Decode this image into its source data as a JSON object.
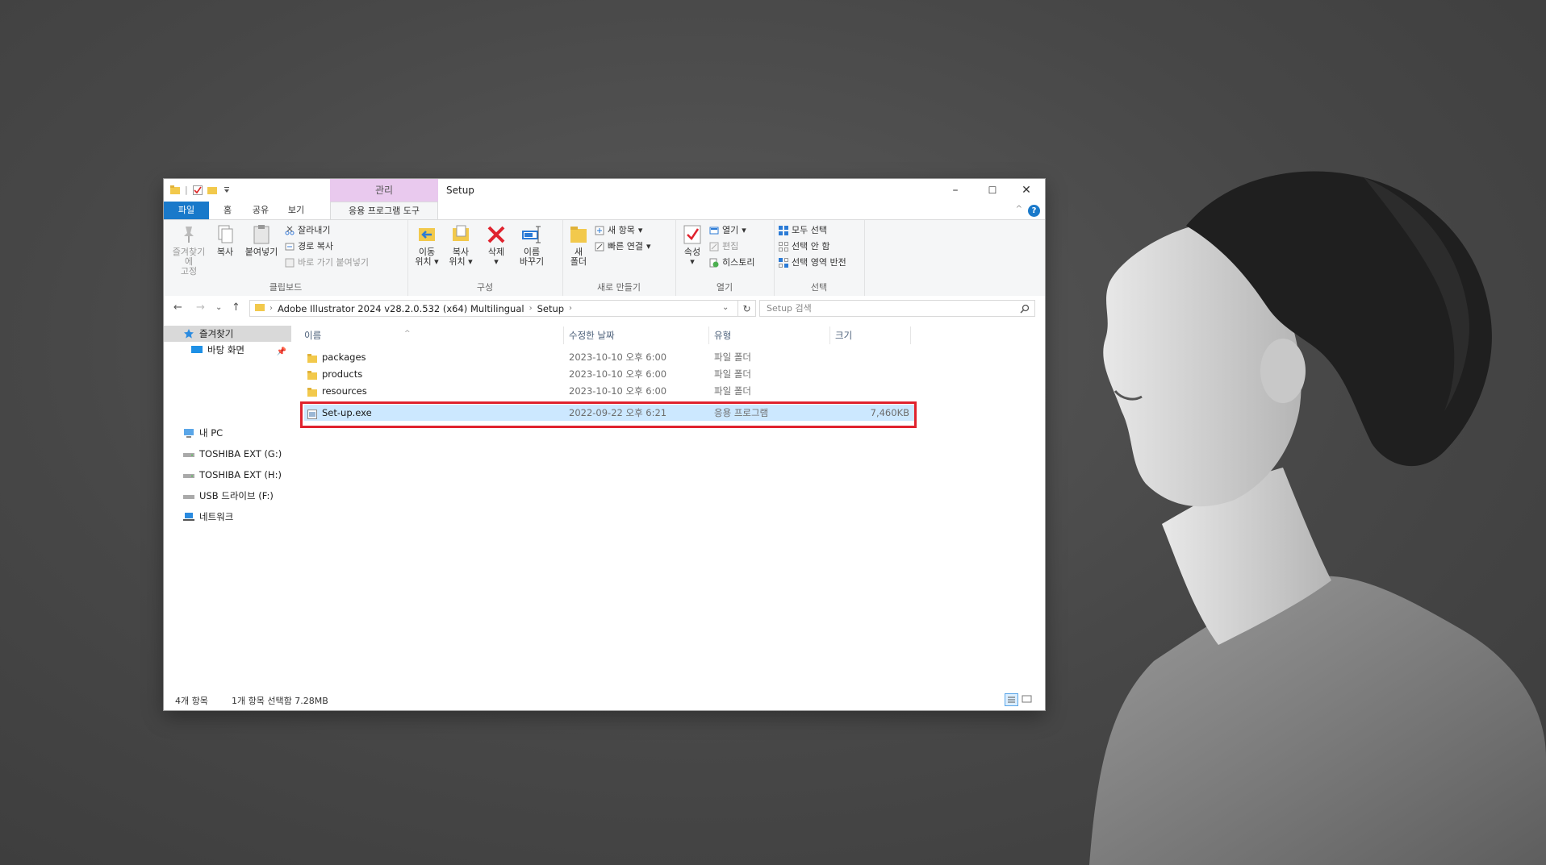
{
  "window": {
    "quick_access_sep": "|",
    "manage_tab": "관리",
    "title": "Setup",
    "controls": {
      "minimize": "–",
      "maximize": "☐",
      "close": "✕"
    }
  },
  "tabs": {
    "file": "파일",
    "home": "홈",
    "share": "공유",
    "view": "보기",
    "app_tools": "응용 프로그램 도구",
    "help": "?",
    "collapse": "^"
  },
  "ribbon": {
    "clipboard": {
      "label": "클립보드",
      "pin_l1": "즐겨찾기에",
      "pin_l2": "고정",
      "copy": "복사",
      "paste": "붙여넣기",
      "cut": "잘라내기",
      "copy_path": "경로 복사",
      "paste_shortcut": "바로 가기 붙여넣기"
    },
    "organize": {
      "label": "구성",
      "move_l1": "이동",
      "move_l2": "위치",
      "copyto_l1": "복사",
      "copyto_l2": "위치",
      "delete": "삭제",
      "rename_l1": "이름",
      "rename_l2": "바꾸기"
    },
    "new": {
      "label": "새로 만들기",
      "newfolder_l1": "새",
      "newfolder_l2": "폴더",
      "new_item": "새 항목",
      "easy_access": "빠른 연결"
    },
    "open": {
      "label": "열기",
      "properties": "속성",
      "open": "열기",
      "edit": "편집",
      "history": "히스토리"
    },
    "select": {
      "label": "선택",
      "select_all": "모두 선택",
      "select_none": "선택 안 함",
      "invert": "선택 영역 반전"
    }
  },
  "address": {
    "back": "←",
    "forward": "→",
    "recent": "⌄",
    "up": "↑",
    "crumbs": [
      "Adobe Illustrator 2024 v28.2.0.532 (x64) Multilingual",
      "Setup"
    ],
    "refresh": "↻",
    "search_placeholder": "Setup 검색"
  },
  "nav": {
    "quick_access": "즐겨찾기",
    "desktop": "바탕 화면",
    "this_pc": "내 PC",
    "drive_g": "TOSHIBA EXT (G:)",
    "drive_h": "TOSHIBA EXT (H:)",
    "drive_f": "USB 드라이브 (F:)",
    "network": "네트워크"
  },
  "columns": {
    "name": "이름",
    "date": "수정한 날짜",
    "type": "유형",
    "size": "크기"
  },
  "files": [
    {
      "name": "packages",
      "date": "2023-10-10 오후 6:00",
      "type": "파일 폴더",
      "size": ""
    },
    {
      "name": "products",
      "date": "2023-10-10 오후 6:00",
      "type": "파일 폴더",
      "size": ""
    },
    {
      "name": "resources",
      "date": "2023-10-10 오후 6:00",
      "type": "파일 폴더",
      "size": ""
    },
    {
      "name": "Set-up.exe",
      "date": "2022-09-22 오후 6:21",
      "type": "응용 프로그램",
      "size": "7,460KB"
    }
  ],
  "status": {
    "count": "4개 항목",
    "selected": "1개 항목 선택함 7.28MB"
  },
  "colors": {
    "accent": "#1979ca",
    "manage_tab": "#e9c9ee",
    "selection": "#cce8ff",
    "highlight": "#e0232e",
    "folder": "#f2c94c"
  }
}
